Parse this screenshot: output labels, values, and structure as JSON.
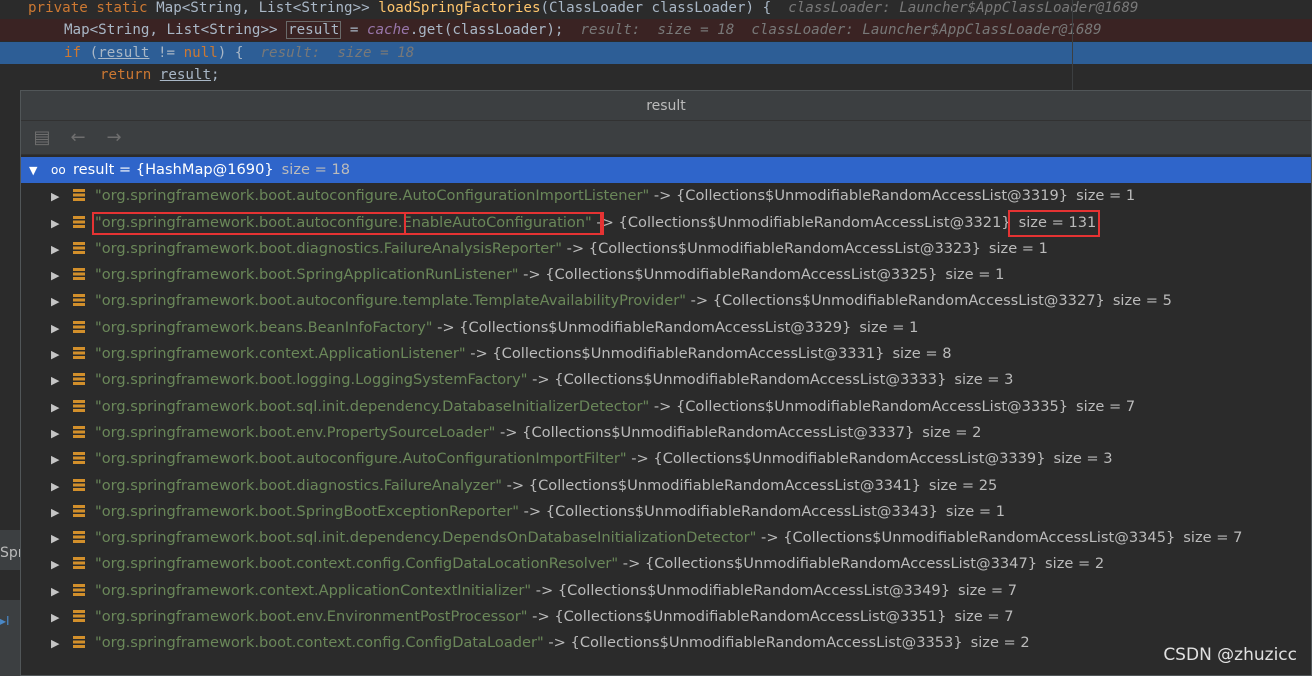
{
  "editor": {
    "line1": {
      "kw": "private static ",
      "type": "Map<String, List<String>> ",
      "method": "loadSpringFactories",
      "params": "(ClassLoader classLoader) {",
      "hint": "  classLoader: Launcher$AppClassLoader@1689"
    },
    "line2": {
      "type": "Map<String, List<String>> ",
      "var": "result",
      "assign": " = ",
      "field": "cache",
      "call": ".get(classLoader);",
      "hint": "  result:  size = 18  classLoader: Launcher$AppClassLoader@1689"
    },
    "line3": {
      "kw": "if",
      "open": " (",
      "var": "result",
      "op": " != ",
      "null": "null",
      "close": ") {",
      "hint": "  result:  size = 18"
    },
    "line4": {
      "kw": "return ",
      "var": "result",
      "end": ";"
    },
    "stray_text": "Spr"
  },
  "popup": {
    "title": "result",
    "toolbar": {
      "folder_icon": "folder-icon",
      "back_icon": "back-arrow-icon",
      "forward_icon": "forward-arrow-icon"
    },
    "root": {
      "label": "result = {HashMap@1690}",
      "size": "size = 18"
    },
    "entries": [
      {
        "key": "\"org.springframework.boot.autoconfigure.AutoConfigurationImportListener\"",
        "value": "{Collections$UnmodifiableRandomAccessList@3319}",
        "size": "size = 1"
      },
      {
        "key_prefix": "\"org.springframework.boot.autoconfigure.",
        "key_suffix": "EnableAutoConfiguration\"",
        "value": "{Collections$UnmodifiableRandomAccessList@3321}",
        "size": "size = 131"
      },
      {
        "key": "\"org.springframework.boot.diagnostics.FailureAnalysisReporter\"",
        "value": "{Collections$UnmodifiableRandomAccessList@3323}",
        "size": "size = 1"
      },
      {
        "key": "\"org.springframework.boot.SpringApplicationRunListener\"",
        "value": "{Collections$UnmodifiableRandomAccessList@3325}",
        "size": "size = 1"
      },
      {
        "key": "\"org.springframework.boot.autoconfigure.template.TemplateAvailabilityProvider\"",
        "value": "{Collections$UnmodifiableRandomAccessList@3327}",
        "size": "size = 5"
      },
      {
        "key": "\"org.springframework.beans.BeanInfoFactory\"",
        "value": "{Collections$UnmodifiableRandomAccessList@3329}",
        "size": "size = 1"
      },
      {
        "key": "\"org.springframework.context.ApplicationListener\"",
        "value": "{Collections$UnmodifiableRandomAccessList@3331}",
        "size": "size = 8"
      },
      {
        "key": "\"org.springframework.boot.logging.LoggingSystemFactory\"",
        "value": "{Collections$UnmodifiableRandomAccessList@3333}",
        "size": "size = 3"
      },
      {
        "key": "\"org.springframework.boot.sql.init.dependency.DatabaseInitializerDetector\"",
        "value": "{Collections$UnmodifiableRandomAccessList@3335}",
        "size": "size = 7"
      },
      {
        "key": "\"org.springframework.boot.env.PropertySourceLoader\"",
        "value": "{Collections$UnmodifiableRandomAccessList@3337}",
        "size": "size = 2"
      },
      {
        "key": "\"org.springframework.boot.autoconfigure.AutoConfigurationImportFilter\"",
        "value": "{Collections$UnmodifiableRandomAccessList@3339}",
        "size": "size = 3"
      },
      {
        "key": "\"org.springframework.boot.diagnostics.FailureAnalyzer\"",
        "value": "{Collections$UnmodifiableRandomAccessList@3341}",
        "size": "size = 25"
      },
      {
        "key": "\"org.springframework.boot.SpringBootExceptionReporter\"",
        "value": "{Collections$UnmodifiableRandomAccessList@3343}",
        "size": "size = 1"
      },
      {
        "key": "\"org.springframework.boot.sql.init.dependency.DependsOnDatabaseInitializationDetector\"",
        "value": "{Collections$UnmodifiableRandomAccessList@3345}",
        "size": "size = 7"
      },
      {
        "key": "\"org.springframework.boot.context.config.ConfigDataLocationResolver\"",
        "value": "{Collections$UnmodifiableRandomAccessList@3347}",
        "size": "size = 2"
      },
      {
        "key": "\"org.springframework.context.ApplicationContextInitializer\"",
        "value": "{Collections$UnmodifiableRandomAccessList@3349}",
        "size": "size = 7"
      },
      {
        "key": "\"org.springframework.boot.env.EnvironmentPostProcessor\"",
        "value": "{Collections$UnmodifiableRandomAccessList@3351}",
        "size": "size = 7"
      },
      {
        "key": "\"org.springframework.boot.context.config.ConfigDataLoader\"",
        "value": "{Collections$UnmodifiableRandomAccessList@3353}",
        "size": "size = 2"
      }
    ],
    "arrow": "->"
  },
  "watermark": "CSDN @zhuzicc",
  "colors": {
    "selection": "#2f65ca",
    "string_key": "#6a8759",
    "highlight_box": "#e53333",
    "list_icon": "#d28f2b"
  }
}
